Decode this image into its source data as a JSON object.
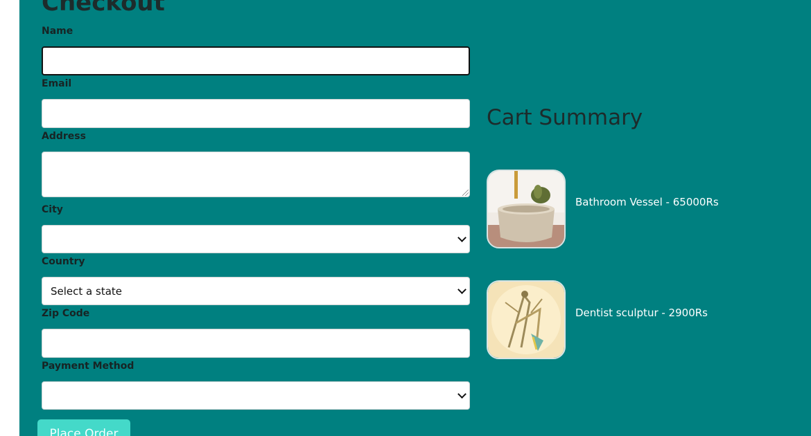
{
  "checkout": {
    "title": "Checkout",
    "fields": {
      "name_label": "Name",
      "email_label": "Email",
      "address_label": "Address",
      "city_label": "City",
      "country_label": "Country",
      "country_value": "Select a state",
      "zip_label": "Zip Code",
      "payment_label": "Payment Method"
    },
    "place_order_label": "Place Order"
  },
  "cart": {
    "title": "Cart Summary",
    "items": [
      {
        "label": "Bathroom Vessel - 65000Rs"
      },
      {
        "label": "Dentist sculptur - 2900Rs"
      }
    ]
  },
  "colors": {
    "panel_bg": "#008080",
    "button_bg": "#44d9c9"
  }
}
